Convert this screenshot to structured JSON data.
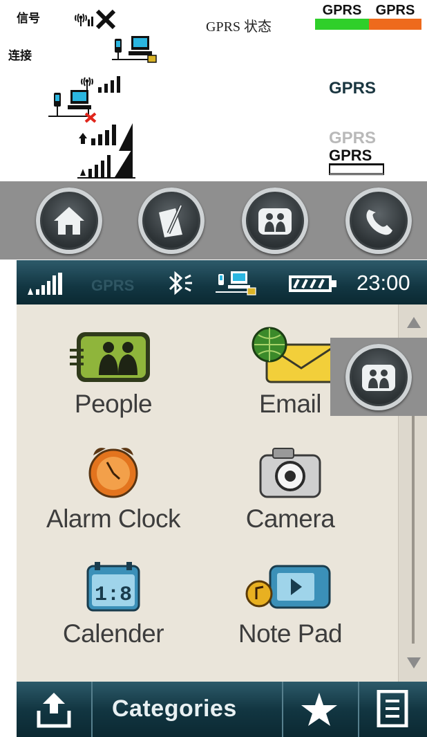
{
  "legend": {
    "signal_label": "信号",
    "connect_label": "连接",
    "gprs_status_label": "GPRS 状态",
    "gprs_green": "GPRS",
    "gprs_orange": "GPRS",
    "gprs_active": "GPRS",
    "gprs_inactive": "GPRS",
    "gprs_boxed": "GPRS"
  },
  "status_bar": {
    "network": "GPRS",
    "time": "23:00"
  },
  "apps": [
    {
      "label": "People",
      "icon": "people-icon"
    },
    {
      "label": "Email",
      "icon": "email-icon"
    },
    {
      "label": "Alarm Clock",
      "icon": "alarm-clock-icon"
    },
    {
      "label": "Camera",
      "icon": "camera-icon"
    },
    {
      "label": "Calender",
      "icon": "calendar-icon"
    },
    {
      "label": "Note Pad",
      "icon": "note-pad-icon"
    }
  ],
  "bottom_bar": {
    "categories_label": "Categories"
  },
  "colors": {
    "gprs_green": "#2fcf2a",
    "gprs_orange": "#ee6a1c",
    "status_bar": "#123642",
    "toolbar": "#8f8f8f",
    "screen_bg": "#eae5da"
  }
}
